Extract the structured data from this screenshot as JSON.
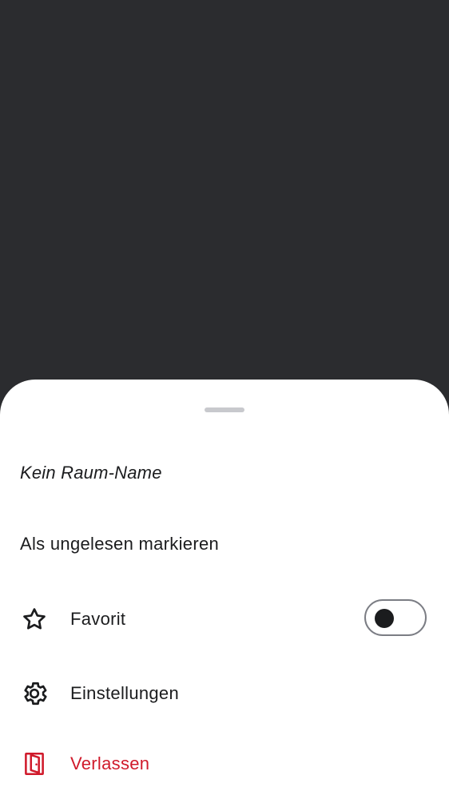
{
  "sheet": {
    "title": "Kein Raum-Name",
    "items": [
      {
        "id": "mark-unread",
        "label": "Als ungelesen markieren"
      },
      {
        "id": "favorite",
        "label": "Favorit",
        "icon": "star-icon",
        "toggle_on": false
      },
      {
        "id": "settings",
        "label": "Einstellungen",
        "icon": "gear-icon"
      },
      {
        "id": "leave",
        "label": "Verlassen",
        "icon": "door-exit-icon"
      }
    ]
  },
  "colors": {
    "backdrop": "#2b2c2f",
    "sheet": "#ffffff",
    "text": "#1b1c1e",
    "danger": "#d01a2b",
    "toggle_outline": "#7b7d84"
  }
}
